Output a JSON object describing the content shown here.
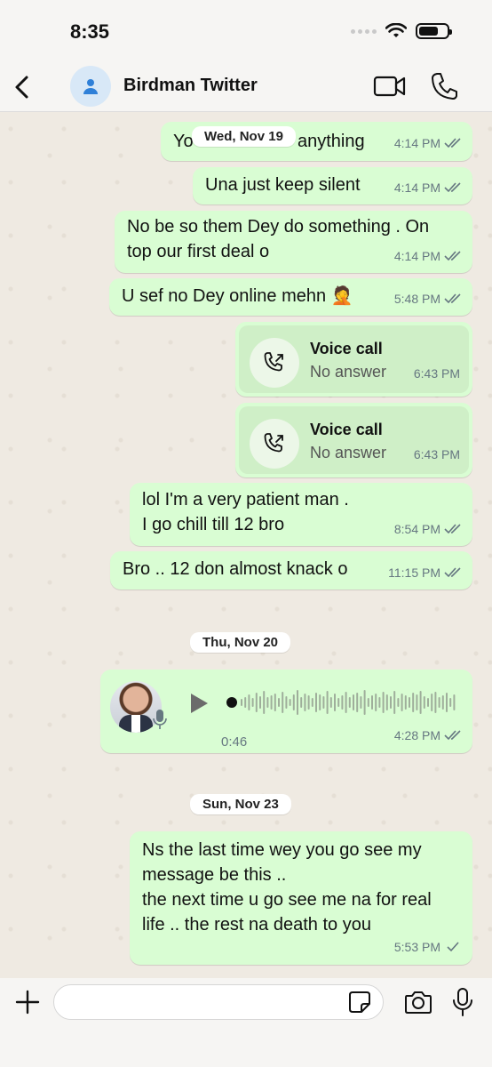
{
  "status": {
    "time": "8:35"
  },
  "header": {
    "contact_name": "Birdman Twitter"
  },
  "dates": {
    "d1": "Wed, Nov 19",
    "d2": "Thu, Nov 20",
    "d3": "Sun, Nov 23"
  },
  "messages": [
    {
      "text": "Yo",
      "text_tail": "anything",
      "time": "4:14 PM",
      "status": "read"
    },
    {
      "text": "Una just keep silent",
      "time": "4:14 PM",
      "status": "read"
    },
    {
      "text": "No be so them Dey do something . On\ntop our first deal o",
      "time": "4:14 PM",
      "status": "read"
    },
    {
      "text": "U sef no Dey online mehn 🤦",
      "time": "5:48 PM",
      "status": "read"
    },
    {
      "text": "lol I'm a very patient man .\nI go chill till 12 bro",
      "time": "8:54 PM",
      "status": "read"
    },
    {
      "text": "Bro .. 12 don almost knack o",
      "time": "11:15 PM",
      "status": "read"
    },
    {
      "text": "Ns the last time wey you go see my\nmessage be this ..\nthe next time u go see me na for real\nlife .. the rest na death to you",
      "time": "5:53 PM",
      "status": "sent"
    }
  ],
  "calls": [
    {
      "title": "Voice call",
      "subtitle": "No answer",
      "time": "6:43 PM"
    },
    {
      "title": "Voice call",
      "subtitle": "No answer",
      "time": "6:43 PM"
    }
  ],
  "voice_note": {
    "duration": "0:46",
    "time": "4:28 PM",
    "status": "read",
    "progress": 0
  },
  "input": {
    "placeholder": "",
    "value": ""
  },
  "colors": {
    "bubble_out": "#d9fdd3",
    "chat_bg": "#efeae2",
    "tick_read": "#667781"
  },
  "icons": {
    "back": "chevron-left-icon",
    "avatar": "person-icon",
    "video": "video-camera-icon",
    "phone": "phone-icon",
    "call_out": "outgoing-call-icon",
    "play": "play-icon",
    "plus": "plus-icon",
    "sticker": "sticker-icon",
    "camera": "camera-icon",
    "mic": "microphone-icon"
  }
}
